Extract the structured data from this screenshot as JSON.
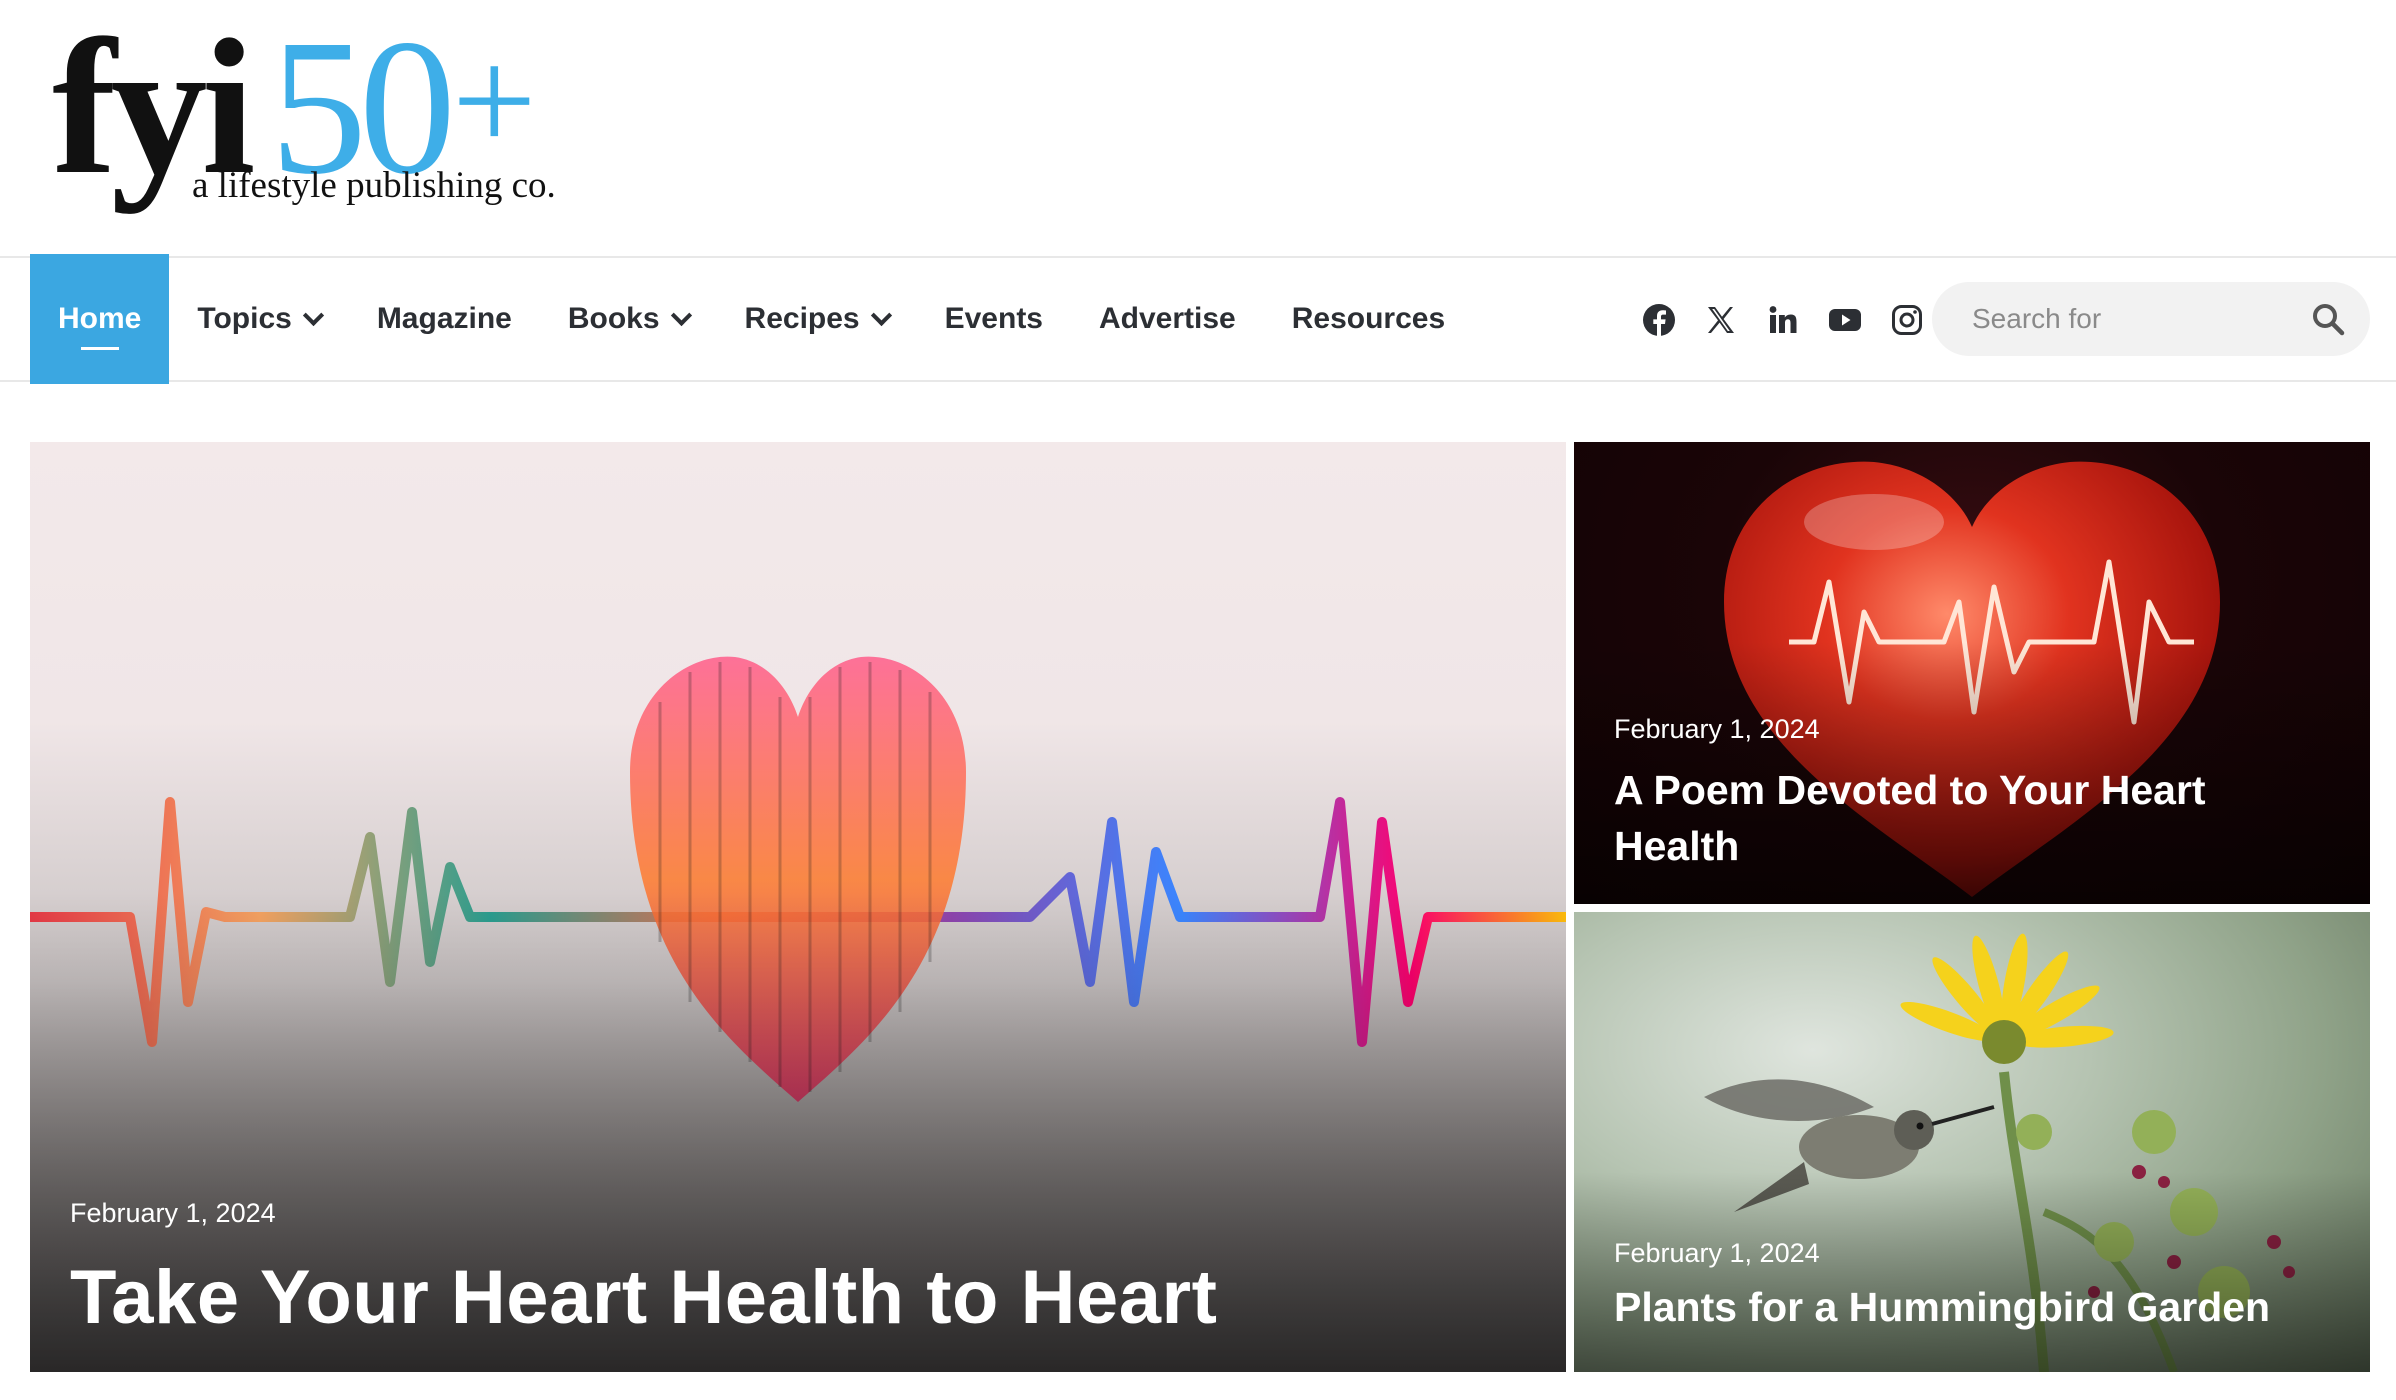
{
  "brand": {
    "logo_word": "fyi",
    "logo_number": "50",
    "logo_plus": "+",
    "tagline": "a lifestyle publishing co.",
    "accent_color": "#3ba7e1"
  },
  "nav": {
    "items": [
      {
        "label": "Home",
        "active": true,
        "has_dropdown": false
      },
      {
        "label": "Topics",
        "active": false,
        "has_dropdown": true
      },
      {
        "label": "Magazine",
        "active": false,
        "has_dropdown": false
      },
      {
        "label": "Books",
        "active": false,
        "has_dropdown": true
      },
      {
        "label": "Recipes",
        "active": false,
        "has_dropdown": true
      },
      {
        "label": "Events",
        "active": false,
        "has_dropdown": false
      },
      {
        "label": "Advertise",
        "active": false,
        "has_dropdown": false
      },
      {
        "label": "Resources",
        "active": false,
        "has_dropdown": false
      }
    ],
    "social_icons": [
      "facebook-icon",
      "x-icon",
      "linkedin-icon",
      "youtube-icon",
      "instagram-icon"
    ],
    "search": {
      "placeholder": "Search for",
      "value": ""
    }
  },
  "featured": {
    "main": {
      "date": "February 1, 2024",
      "title": "Take Your Heart Health to Heart"
    },
    "side_top": {
      "date": "February 1, 2024",
      "title": "A Poem Devoted to Your Heart Health"
    },
    "side_bottom": {
      "date": "February 1, 2024",
      "title": "Plants for a Hummingbird Garden"
    }
  }
}
